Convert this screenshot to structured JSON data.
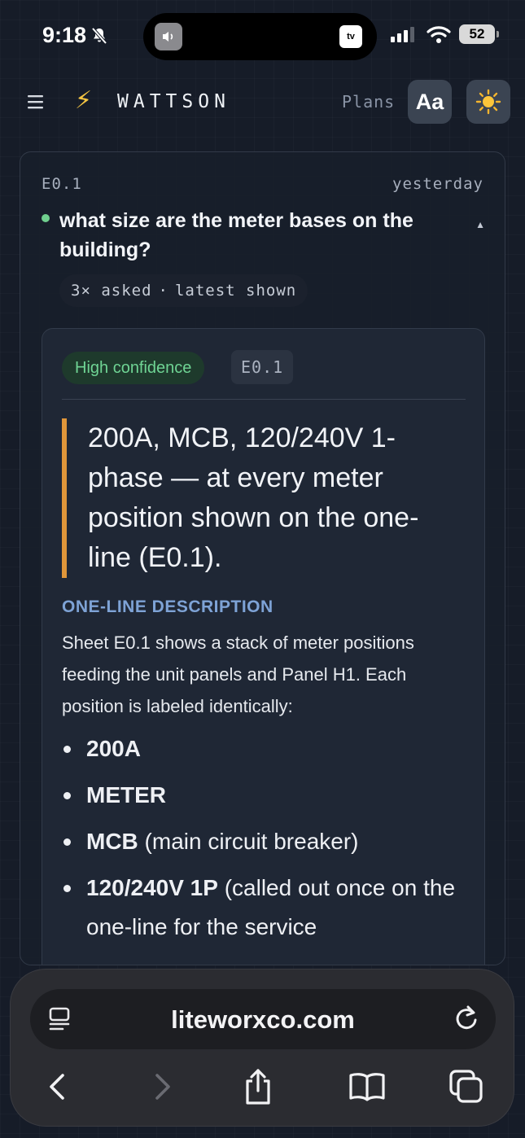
{
  "status_bar": {
    "time": "9:18",
    "island_right_label": "tv",
    "battery": "52"
  },
  "header": {
    "brand": "WATTSON",
    "plans_label": "Plans",
    "font_button_label": "Aa"
  },
  "thread": {
    "sheet_id": "E0.1",
    "timestamp": "yesterday",
    "question": "what size are the meter bases on the building?",
    "asked_count": "3× asked",
    "separator": "·",
    "asked_suffix": "latest shown"
  },
  "answer": {
    "confidence": "High confidence",
    "sheet_chip": "E0.1",
    "quote": "200A, MCB, 120/240V 1-phase — at every meter position shown on the one-line (E0.1).",
    "section_heading": "ONE-LINE DESCRIPTION",
    "section_body": "Sheet E0.1 shows a stack of meter positions feeding the unit panels and Panel H1. Each position is labeled identically:",
    "bullets": [
      {
        "bold": "200A",
        "rest": ""
      },
      {
        "bold": "METER",
        "rest": ""
      },
      {
        "bold": "MCB",
        "rest": " (main circuit breaker)"
      },
      {
        "bold": "120/240V 1P",
        "rest": " (called out once on the one-line for the service"
      }
    ]
  },
  "browser": {
    "url": "liteworxco.com"
  },
  "colors": {
    "background": "#161c28",
    "accent_orange": "#e0963a",
    "confidence_green": "#6fd494",
    "heading_blue": "#7ea3d6"
  }
}
